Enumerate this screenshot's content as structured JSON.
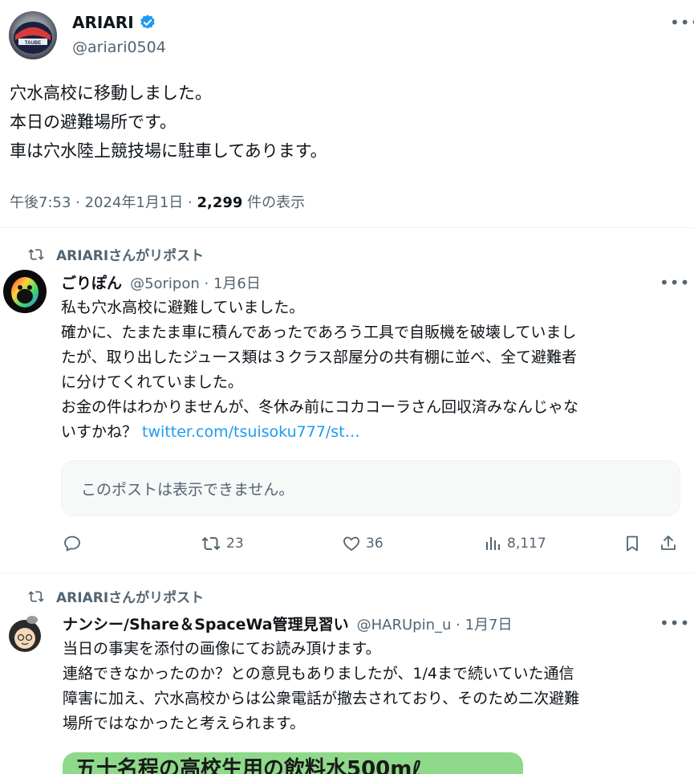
{
  "main_tweet": {
    "author_name": "ARIARI",
    "author_handle": "@ariari0504",
    "avatar_text": "TAUBE",
    "lines": [
      "穴水高校に移動しました。",
      "本日の避難場所です。",
      "車は穴水陸上競技場に駐車してあります。"
    ],
    "time": "午後7:53 · 2024年1月1日 · ",
    "views_count": "2,299",
    "views_label": " 件の表示"
  },
  "repost1": {
    "repost_label": "ARIARIさんがリポスト",
    "author_name": "ごりぽん",
    "meta": "@5oripon · 1月6日",
    "lines": [
      "私も穴水高校に避難していました。",
      "確かに、たまたま車に積んであったであろう工具で自販機を破壊していまし",
      "たが、取り出したジュース類は３クラス部屋分の共有棚に並べ、全て避難者",
      "に分けてくれていました。",
      "お金の件はわかりませんが、冬休み前にコカコーラさん回収済みなんじゃな"
    ],
    "last_line_prefix": "いすかね？ ",
    "link": "twitter.com/tsuisoku777/st…",
    "quote_unavailable": "このポストは表示できません。",
    "retweets": "23",
    "likes": "36",
    "views": "8,117"
  },
  "repost2": {
    "repost_label": "ARIARIさんがリポスト",
    "author_name": "ナンシー/Share＆SpaceWa管理見習い",
    "meta": "@HARUpin_u · 1月7日",
    "lines": [
      "当日の事実を添付の画像にてお読み頂けます。",
      "連絡できなかったのか？との意見もありましたが、1/4まで続いていた通信",
      "障害に加え、穴水高校からは公衆電話が撤去されており、そのため二次避難",
      "場所ではなかったと考えられます。"
    ],
    "image_text": "五十名程の高校生用の飲料水500mℓ"
  },
  "colors": {
    "accent": "#1d9bf0",
    "muted": "#536471",
    "image_green": "#8ed98a"
  }
}
